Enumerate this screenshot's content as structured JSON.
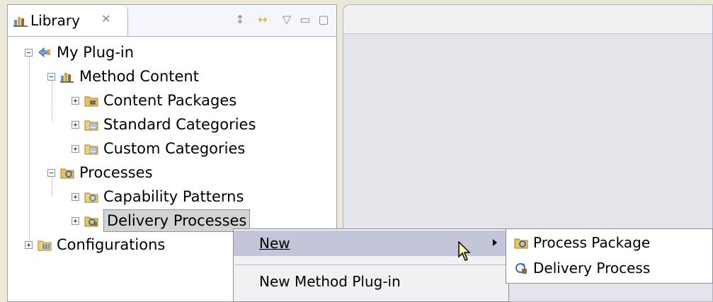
{
  "library": {
    "title": "Library",
    "close_glyph": "✕",
    "buttons": [
      {
        "icon": "sort-icon",
        "glyph": "↕"
      },
      {
        "icon": "link-icon",
        "glyph": "↔"
      },
      {
        "icon": "view-menu-icon",
        "glyph": "▽"
      },
      {
        "icon": "minimize-icon",
        "glyph": "▭"
      },
      {
        "icon": "maximize-icon",
        "glyph": "▢"
      }
    ],
    "tree": [
      {
        "label": "My Plug-in",
        "expander": "minus",
        "icon": "plugin-icon"
      },
      {
        "label": "Method Content",
        "expander": "minus",
        "icon": "method-content-icon"
      },
      {
        "label": "Content Packages",
        "expander": "plus",
        "icon": "content-package-icon"
      },
      {
        "label": "Standard Categories",
        "expander": "plus",
        "icon": "category-folder-icon"
      },
      {
        "label": "Custom Categories",
        "expander": "plus",
        "icon": "category-folder-icon"
      },
      {
        "label": "Processes",
        "expander": "minus",
        "icon": "processes-icon"
      },
      {
        "label": "Capability Patterns",
        "expander": "plus",
        "icon": "capability-pattern-icon"
      },
      {
        "label": "Delivery Processes",
        "expander": "plus",
        "icon": "delivery-process-folder-icon",
        "selected": true
      },
      {
        "label": "Configurations",
        "expander": "plus",
        "icon": "configurations-icon"
      }
    ]
  },
  "context_menu": {
    "items": [
      {
        "label": "New",
        "has_submenu": true,
        "highlighted": true
      },
      {
        "label": "New Method Plug-in"
      }
    ]
  },
  "submenu": {
    "items": [
      {
        "label": "Process Package",
        "icon": "process-package-icon"
      },
      {
        "label": "Delivery Process",
        "icon": "delivery-process-icon"
      }
    ]
  },
  "colors": {
    "selection": "#d3d3d3",
    "menu_highlight": "#c2c6d8",
    "panel_border": "#9aa3b5"
  }
}
